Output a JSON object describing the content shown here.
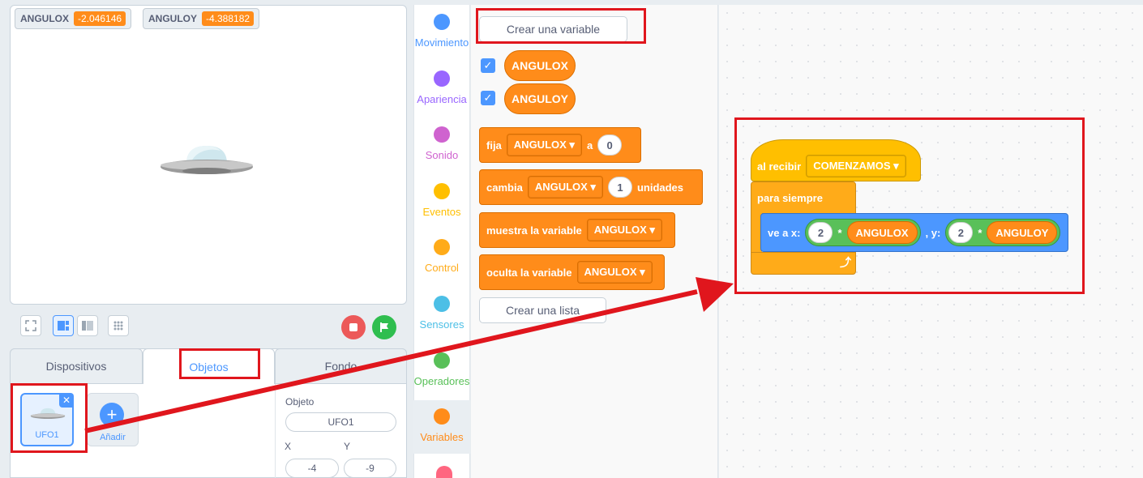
{
  "stage": {
    "monitors": [
      {
        "name": "ANGULOX",
        "value": "-2.046146"
      },
      {
        "name": "ANGULOY",
        "value": "-4.388182"
      }
    ]
  },
  "sprite_panel": {
    "tabs": [
      "Dispositivos",
      "Objetos",
      "Fondo"
    ],
    "sprite_name": "UFO1",
    "add_label": "Añadir",
    "object_label": "Objeto",
    "object_value": "UFO1",
    "x_label": "X",
    "y_label": "Y",
    "x_value": "-4",
    "y_value": "-9"
  },
  "categories": [
    {
      "label": "Movimiento",
      "color": "#4c97ff"
    },
    {
      "label": "Apariencia",
      "color": "#9966ff"
    },
    {
      "label": "Sonido",
      "color": "#cf63cf"
    },
    {
      "label": "Eventos",
      "color": "#ffbf00"
    },
    {
      "label": "Control",
      "color": "#ffab19"
    },
    {
      "label": "Sensores",
      "color": "#4cbfe6"
    },
    {
      "label": "Operadores",
      "color": "#59c059"
    },
    {
      "label": "Variables",
      "color": "#ff8c1a"
    }
  ],
  "palette": {
    "make_variable": "Crear una variable",
    "variables": [
      "ANGULOX",
      "ANGULOY"
    ],
    "set_block": {
      "label": "fija",
      "var": "ANGULOX ▾",
      "to": "a",
      "value": "0"
    },
    "change_block": {
      "label": "cambia",
      "var": "ANGULOX ▾",
      "value": "1",
      "unit": "unidades"
    },
    "show_block": {
      "label": "muestra la variable",
      "var": "ANGULOX ▾"
    },
    "hide_block": {
      "label": "oculta la variable",
      "var": "ANGULOX ▾"
    },
    "make_list": "Crear una lista"
  },
  "script": {
    "hat_label": "al recibir",
    "hat_message": "COMENZAMOS ▾",
    "forever_label": "para siempre",
    "goto_label": "ve a x:",
    "x_num": "2",
    "x_op": "*",
    "x_var": "ANGULOX",
    "y_label": ", y:",
    "y_num": "2",
    "y_op": "*",
    "y_var": "ANGULOY",
    "loop_arrow": "⤴"
  }
}
